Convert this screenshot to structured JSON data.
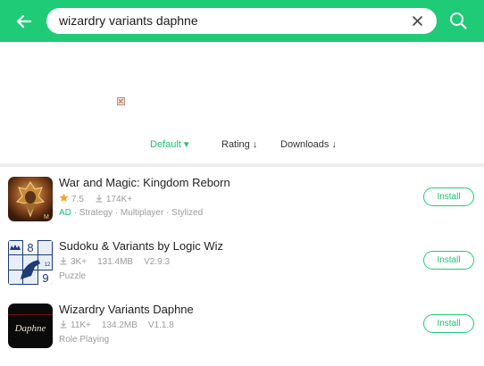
{
  "search": {
    "query": "wizardry variants daphne"
  },
  "sort": {
    "default_label": "Default ▾",
    "rating_label": "Rating ↓",
    "downloads_label": "Downloads ↓"
  },
  "colors": {
    "accent": "#1fcb77",
    "star": "#f5a623"
  },
  "apps": [
    {
      "title": "War and Magic: Kingdom Reborn",
      "rating": "7.5",
      "downloads": "174K+",
      "ad": "AD",
      "tags": "· Strategy · Multiplayer · Stylized",
      "install": "Install",
      "icon": "war-and-magic-icon"
    },
    {
      "title": "Sudoku & Variants by Logic Wiz",
      "downloads": "3K+",
      "size": "131.4MB",
      "version": "V2.9.3",
      "tags": "Puzzle",
      "install": "Install",
      "icon": "sudoku-icon"
    },
    {
      "title": "Wizardry Variants Daphne",
      "downloads": "11K+",
      "size": "134.2MB",
      "version": "V1.1.8",
      "tags": "Role Playing",
      "install": "Install",
      "icon": "wizardry-daphne-icon",
      "icon_text": "Daphne"
    }
  ]
}
